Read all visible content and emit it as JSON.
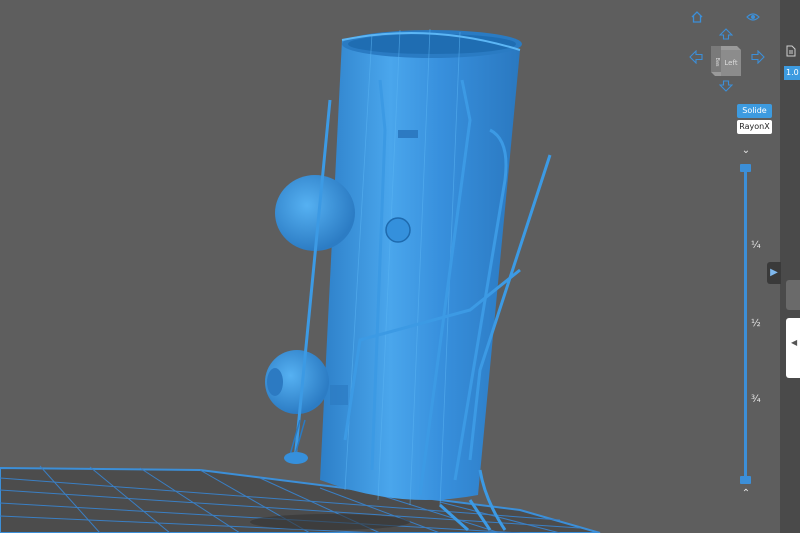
{
  "navigation": {
    "home_icon": "home-icon",
    "visibility_icon": "eye-icon",
    "arrows": [
      "up-arrow-icon",
      "left-arrow-icon",
      "right-arrow-icon",
      "down-arrow-icon"
    ]
  },
  "viewcube": {
    "front_face": "Left",
    "side_face": "Bas"
  },
  "render_mode": {
    "solid_label": "Solide",
    "xray_label": "RayonX",
    "active": "Solide"
  },
  "slider": {
    "ticks": [
      "¼",
      "½",
      "¾"
    ],
    "up_icon": "chevron-up-icon",
    "down_icon": "chevron-down-icon"
  },
  "side_panel": {
    "tab_label": "1.0",
    "expand_icon": "chevron-right-icon",
    "collapse_icon": "chevron-left-icon"
  },
  "colors": {
    "model": "#3d93dc",
    "background": "#5e5e5e",
    "accent": "#3c8fd8",
    "build_plate_grid": "#3a7fc4"
  }
}
